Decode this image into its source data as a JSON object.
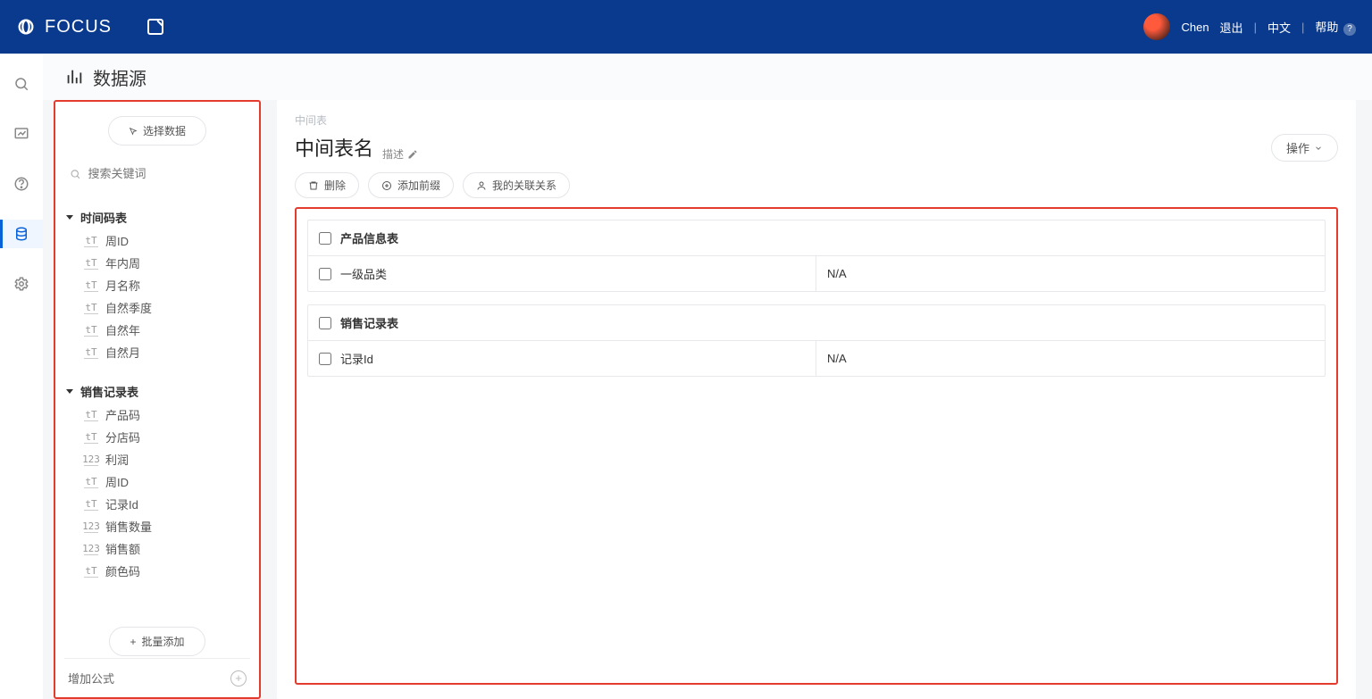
{
  "brand": "FOCUS",
  "header": {
    "username": "Chen",
    "logout": "退出",
    "lang": "中文",
    "help": "帮助"
  },
  "page": {
    "title": "数据源"
  },
  "left": {
    "select_data": "选择数据",
    "search_placeholder": "搜索关键词",
    "batch_add": "批量添加",
    "add_formula": "增加公式",
    "groups": [
      {
        "name": "时间码表",
        "fields": [
          {
            "type": "T",
            "label": "周ID"
          },
          {
            "type": "T",
            "label": "年内周"
          },
          {
            "type": "T",
            "label": "月名称"
          },
          {
            "type": "T",
            "label": "自然季度"
          },
          {
            "type": "T",
            "label": "自然年"
          },
          {
            "type": "T",
            "label": "自然月"
          }
        ]
      },
      {
        "name": "销售记录表",
        "fields": [
          {
            "type": "T",
            "label": "产品码"
          },
          {
            "type": "T",
            "label": "分店码"
          },
          {
            "type": "N",
            "label": "利润"
          },
          {
            "type": "T",
            "label": "周ID"
          },
          {
            "type": "T",
            "label": "记录Id"
          },
          {
            "type": "N",
            "label": "销售数量"
          },
          {
            "type": "N",
            "label": "销售额"
          },
          {
            "type": "T",
            "label": "颜色码"
          }
        ]
      }
    ]
  },
  "main": {
    "breadcrumb": "中间表",
    "title": "中间表名",
    "subtitle": "描述",
    "actions": "操作",
    "toolbar": {
      "delete": "删除",
      "add_prefix": "添加前缀",
      "my_relations": "我的关联关系"
    },
    "tables": [
      {
        "name": "产品信息表",
        "rows": [
          {
            "col": "一级品类",
            "val": "N/A"
          }
        ]
      },
      {
        "name": "销售记录表",
        "rows": [
          {
            "col": "记录Id",
            "val": "N/A"
          }
        ]
      }
    ]
  }
}
